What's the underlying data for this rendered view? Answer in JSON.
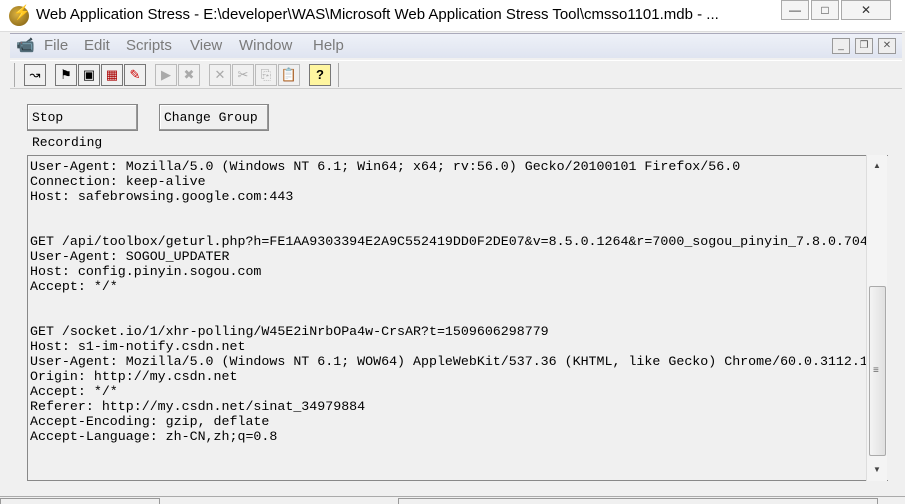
{
  "window": {
    "title": "Web Application Stress - E:\\developer\\WAS\\Microsoft Web Application Stress Tool\\cmsso1101.mdb - ...",
    "minimize": "—",
    "maximize": "□",
    "close": "✕"
  },
  "menu": [
    "File",
    "Edit",
    "Scripts",
    "View",
    "Window",
    "Help"
  ],
  "mdi": {
    "minimize": "_",
    "restore": "❐",
    "close": "✕"
  },
  "toolbar": [
    {
      "icon": "record-icon",
      "glyph": "↝"
    },
    {
      "icon": "checkered-flag-icon",
      "glyph": "⚑"
    },
    {
      "icon": "page-icon",
      "glyph": "▣"
    },
    {
      "icon": "report-icon",
      "glyph": "▦"
    },
    {
      "icon": "settings-icon",
      "glyph": "✎"
    },
    {
      "icon": "play-icon",
      "glyph": "▶"
    },
    {
      "icon": "stop-icon",
      "glyph": "✖"
    },
    {
      "icon": "delete-icon",
      "glyph": "✕"
    },
    {
      "icon": "cut-icon",
      "glyph": "✂"
    },
    {
      "icon": "copy-icon",
      "glyph": "⎘"
    },
    {
      "icon": "paste-icon",
      "glyph": "📋"
    },
    {
      "icon": "help-icon",
      "glyph": "?"
    }
  ],
  "buttons": {
    "stop_recording": "Stop Recording",
    "change_group": "Change Group"
  },
  "log_lines": [
    "User-Agent: Mozilla/5.0 (Windows NT 6.1; Win64; x64; rv:56.0) Gecko/20100101 Firefox/56.0",
    "Connection: keep-alive",
    "Host: safebrowsing.google.com:443",
    "",
    "",
    "GET /api/toolbox/geturl.php?h=FE1AA9303394E2A9C552419DD0F2DE07&v=8.5.0.1264&r=7000_sogou_pinyin_7.8.0.704",
    "User-Agent: SOGOU_UPDATER",
    "Host: config.pinyin.sogou.com",
    "Accept: */*",
    "",
    "",
    "GET /socket.io/1/xhr-polling/W45E2iNrbOPa4w-CrsAR?t=1509606298779",
    "Host: s1-im-notify.csdn.net",
    "User-Agent: Mozilla/5.0 (Windows NT 6.1; WOW64) AppleWebKit/537.36 (KHTML, like Gecko) Chrome/60.0.3112.1",
    "Origin: http://my.csdn.net",
    "Accept: */*",
    "Referer: http://my.csdn.net/sinat_34979884",
    "Accept-Encoding: gzip, deflate",
    "Accept-Language: zh-CN,zh;q=0.8"
  ]
}
